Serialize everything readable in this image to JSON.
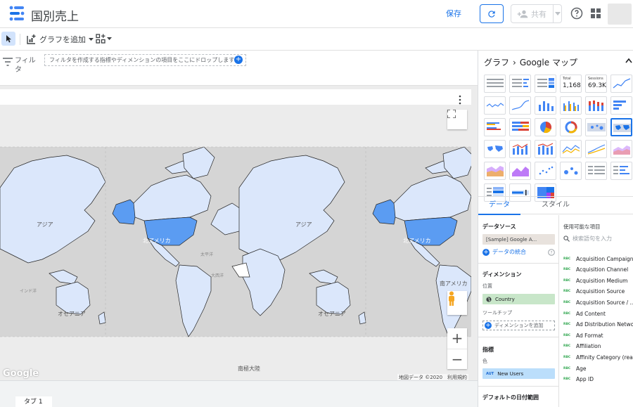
{
  "report": {
    "title": "国別売上"
  },
  "topbar": {
    "save_label": "保存",
    "share_label": "共有"
  },
  "toolbar": {
    "add_chart_label": "グラフを追加"
  },
  "filter": {
    "label": "フィルタ",
    "dropzone_text": "フィルタを作成する指標やディメンションの項目をここにドロップします"
  },
  "map": {
    "labels": {
      "asia_left": "アジア",
      "asia_right": "アジア",
      "north_america_left": "北アメリカ",
      "north_america_right": "北アメリカ",
      "south_america": "南アメリカ",
      "oceania_left": "オセアニア",
      "oceania_right": "オセアニア",
      "antarctica": "南極大陸",
      "pacific_left": "太平洋",
      "atlantic": "大西洋",
      "indian_ocean": "インド洋"
    },
    "attribution": "地図データ ©2020　利用規約",
    "google_logo": "Google",
    "zoom_in": "+",
    "zoom_out": "−"
  },
  "tabs": {
    "page1": "タブ 1"
  },
  "panel": {
    "breadcrumb_root": "グラフ",
    "breadcrumb_separator": "›",
    "breadcrumb_current": "Google マップ",
    "tab_data": "データ",
    "tab_style": "スタイル",
    "scorecard1": {
      "label": "Total",
      "value": "1,168"
    },
    "scorecard2": {
      "label": "Sessions",
      "value": "69.3K"
    },
    "datasource_title": "データソース",
    "datasource_value": "[Sample] Google A...",
    "blend_label": "データの統合",
    "dimension_title": "ディメンション",
    "location_label": "位置",
    "dimension_value": "Country",
    "tooltip_label": "ツールチップ",
    "add_dimension_label": "ディメンションを追加",
    "metric_title": "指標",
    "color_label": "色",
    "metric_badge": "AUT",
    "metric_value": "New Users",
    "date_range_title": "デフォルトの日付範囲",
    "fields_title": "使用可能な項目",
    "field_search_placeholder": "検索語句を入力",
    "field_type": "RBC",
    "fields": [
      "Acquisition Campaign",
      "Acquisition Channel",
      "Acquisition Medium",
      "Acquisition Source",
      "Acquisition Source / ...",
      "Ad Content",
      "Ad Distribution Netwo...",
      "Ad Format",
      "Affiliation",
      "Affinity Category (reac...",
      "Age",
      "App ID"
    ]
  },
  "colors": {
    "accent": "#1a73e8",
    "map_land": "#dbe7fb",
    "map_highlight": "#5b9cf2",
    "map_water": "#d5d5d5"
  }
}
